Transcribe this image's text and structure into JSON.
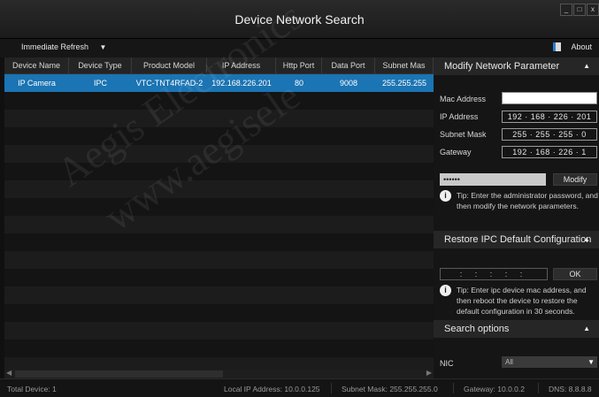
{
  "window": {
    "title": "Device Network Search",
    "min_label": "_",
    "max_label": "□",
    "close_label": "x"
  },
  "toolbar": {
    "refresh_label": "Immediate Refresh",
    "refresh_caret": "▼",
    "about_label": "About"
  },
  "table": {
    "columns": [
      "Device Name",
      "Device Type",
      "Product Model",
      "IP Address",
      "Http Port",
      "Data Port",
      "Subnet Mas"
    ],
    "rows": [
      [
        "IP Camera",
        "IPC",
        "VTC-TNT4RFAD-2",
        "192.168.226.201",
        "80",
        "9008",
        "255.255.255"
      ]
    ]
  },
  "modify": {
    "header": "Modify Network Parameter",
    "mac_label": "Mac Address",
    "mac_value": "",
    "ip_label": "IP Address",
    "ip_value": "192 · 168 · 226 · 201",
    "mask_label": "Subnet Mask",
    "mask_value": "255 · 255 · 255 · 0",
    "gw_label": "Gateway",
    "gw_value": "192 · 168 · 226 · 1",
    "password_value": "••••••",
    "modify_button": "Modify",
    "tip": "Tip: Enter the administrator password, and then modify the network parameters."
  },
  "restore": {
    "header": "Restore IPC Default Configuration",
    "mac_placeholder": ": : : : :",
    "ok_button": "OK",
    "tip": "Tip: Enter ipc device mac address, and then reboot the device to restore the default configuration in 30 seconds."
  },
  "search": {
    "header": "Search options",
    "nic_label": "NIC",
    "nic_value": "All"
  },
  "status": {
    "total": "Total Device: 1",
    "local_ip": "Local IP Address: 10.0.0.125",
    "mask": "Subnet Mask: 255.255.255.0",
    "gateway": "Gateway: 10.0.0.2",
    "dns": "DNS: 8.8.8.8"
  },
  "watermark": {
    "line1": "Aegis Electronics",
    "line2": "www.aegisele"
  },
  "colors": {
    "accent": "#1b74b3",
    "panel": "#151515",
    "header": "#262626"
  }
}
